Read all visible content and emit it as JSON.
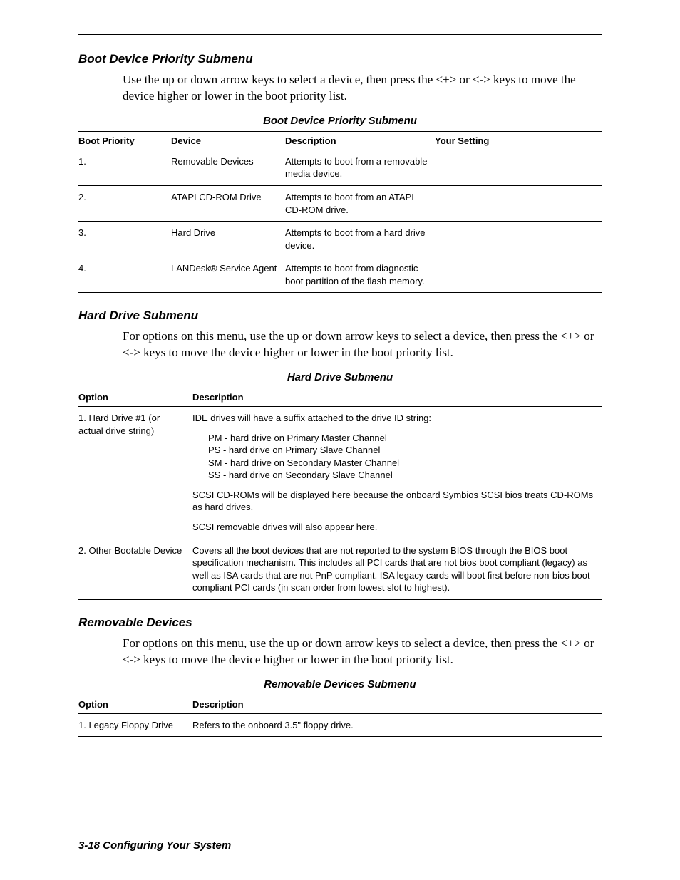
{
  "sections": {
    "boot_priority": {
      "heading": "Boot Device Priority Submenu",
      "body": "Use the up or down arrow keys to select a device, then press the <+> or <-> keys to move the device higher or lower in the boot priority list.",
      "table_title": "Boot Device Priority Submenu",
      "headers": {
        "c1": "Boot Priority",
        "c2": "Device",
        "c3": "Description",
        "c4": "Your Setting"
      },
      "rows": [
        {
          "c1": "1.",
          "c2": "Removable Devices",
          "c3": "Attempts to boot from a removable media device.",
          "c4": ""
        },
        {
          "c1": "2.",
          "c2": "ATAPI CD-ROM Drive",
          "c3": "Attempts to boot from an ATAPI CD-ROM drive.",
          "c4": ""
        },
        {
          "c1": "3.",
          "c2": "Hard Drive",
          "c3": "Attempts to boot from a hard drive device.",
          "c4": ""
        },
        {
          "c1": "4.",
          "c2": "LANDesk® Service Agent",
          "c3": "Attempts to boot from diagnostic boot partition of the flash memory.",
          "c4": ""
        }
      ]
    },
    "hard_drive": {
      "heading": "Hard Drive Submenu",
      "body": "For options on this menu, use the up or down arrow keys to select a device, then press the <+> or <-> keys to move the device higher or lower in the boot priority list.",
      "table_title": "Hard Drive Submenu",
      "headers": {
        "c1": "Option",
        "c2": "Description"
      },
      "rows": [
        {
          "c1": "1. Hard Drive #1 (or actual drive string)",
          "desc_intro": "IDE drives will have a suffix attached to the drive ID string:",
          "suffixes": [
            "PM - hard drive on Primary Master Channel",
            "PS - hard drive on Primary Slave Channel",
            "SM - hard drive on Secondary Master Channel",
            "SS - hard drive on Secondary Slave Channel"
          ],
          "desc_p2": "SCSI CD-ROMs will be displayed here because the onboard Symbios SCSI bios treats CD-ROMs as hard drives.",
          "desc_p3": "SCSI removable drives will also appear here."
        },
        {
          "c1": "2. Other Bootable Device",
          "c2": "Covers all the boot devices that are not reported to the system BIOS through the BIOS boot specification mechanism. This includes all PCI cards that are not bios boot compliant (legacy) as well as ISA cards that are not PnP compliant. ISA legacy cards will boot first before non-bios boot compliant PCI cards (in scan order from lowest slot to highest)."
        }
      ]
    },
    "removable": {
      "heading": "Removable Devices",
      "body": "For options on this menu, use the up or down arrow keys to select a device, then press the <+> or <-> keys to move the device higher or lower in the boot priority list.",
      "table_title": "Removable Devices Submenu",
      "headers": {
        "c1": "Option",
        "c2": "Description"
      },
      "rows": [
        {
          "c1": "1. Legacy Floppy Drive",
          "c2": "Refers to the onboard 3.5\" floppy drive."
        }
      ]
    }
  },
  "footer": "3-18   Configuring Your System"
}
